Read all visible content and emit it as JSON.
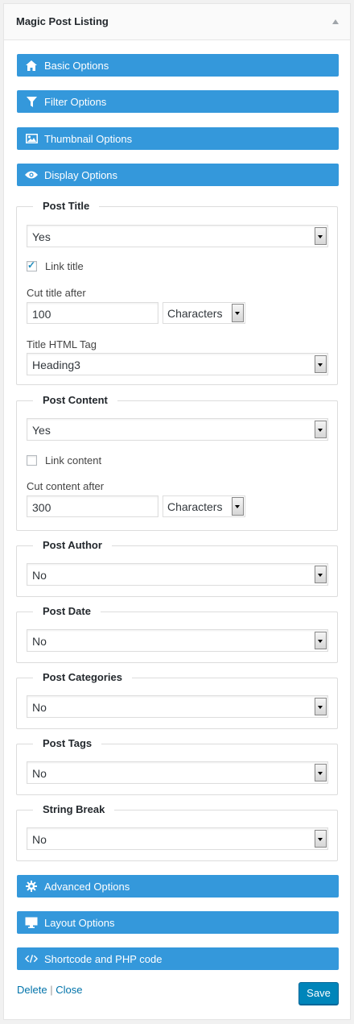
{
  "widget": {
    "title": "Magic Post Listing"
  },
  "sections": {
    "basic": {
      "label": "Basic Options",
      "icon": "home-icon"
    },
    "filter": {
      "label": "Filter Options",
      "icon": "filter-icon"
    },
    "thumbnail": {
      "label": "Thumbnail Options",
      "icon": "image-icon"
    },
    "display": {
      "label": "Display Options",
      "icon": "eye-icon"
    },
    "advanced": {
      "label": "Advanced Options",
      "icon": "gear-icon"
    },
    "layout": {
      "label": "Layout Options",
      "icon": "monitor-icon"
    },
    "shortcode": {
      "label": "Shortcode and PHP code",
      "icon": "code-icon"
    }
  },
  "post_title": {
    "legend": "Post Title",
    "show": "Yes",
    "link_label": "Link title",
    "link_checked": true,
    "cut_label": "Cut title after",
    "cut_value": "100",
    "cut_unit": "Characters",
    "tag_label": "Title HTML Tag",
    "tag_value": "Heading3"
  },
  "post_content": {
    "legend": "Post Content",
    "show": "Yes",
    "link_label": "Link content",
    "link_checked": false,
    "cut_label": "Cut content after",
    "cut_value": "300",
    "cut_unit": "Characters"
  },
  "post_author": {
    "legend": "Post Author",
    "value": "No"
  },
  "post_date": {
    "legend": "Post Date",
    "value": "No"
  },
  "post_categories": {
    "legend": "Post Categories",
    "value": "No"
  },
  "post_tags": {
    "legend": "Post Tags",
    "value": "No"
  },
  "string_break": {
    "legend": "String Break",
    "value": "No"
  },
  "actions": {
    "delete": "Delete",
    "separator": "|",
    "close": "Close",
    "save": "Save"
  },
  "colors": {
    "accent_bar": "#3498db",
    "save_button": "#0085ba",
    "link": "#0073aa"
  }
}
